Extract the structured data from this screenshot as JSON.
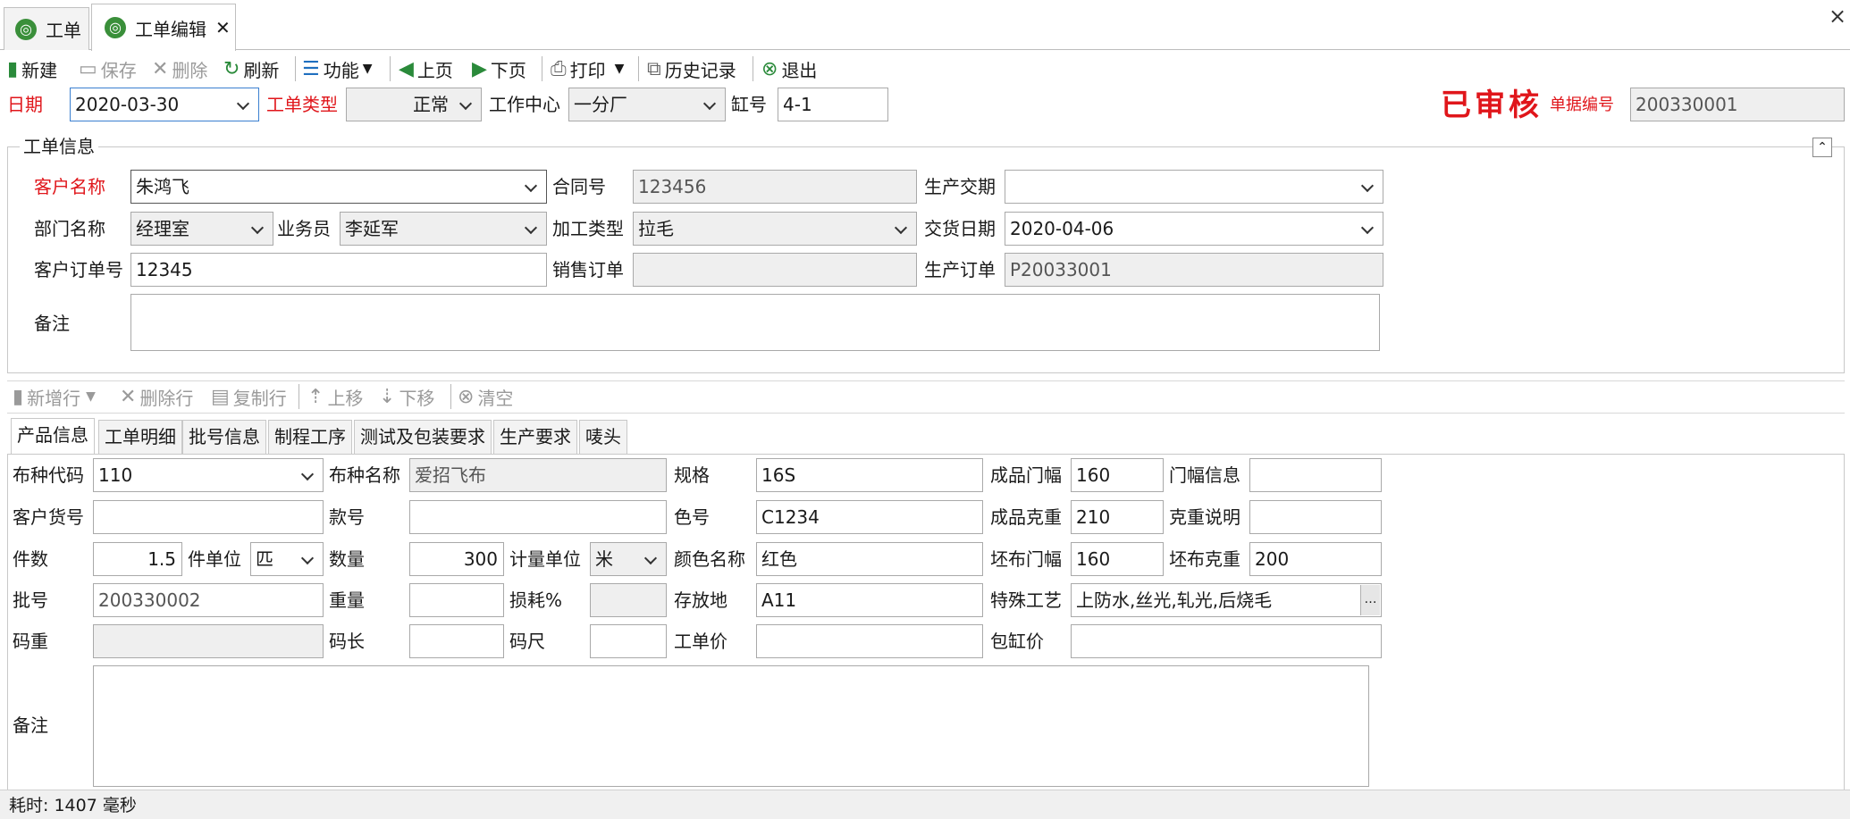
{
  "tabs": [
    {
      "label": "工单"
    },
    {
      "label": "工单编辑"
    }
  ],
  "window_close": "×",
  "toolbar": {
    "new": "新建",
    "save": "保存",
    "delete": "删除",
    "refresh": "刷新",
    "func": "功能",
    "prev": "上页",
    "next": "下页",
    "print": "打印",
    "history": "历史记录",
    "exit": "退出"
  },
  "header": {
    "date_label": "日期",
    "date": "2020-03-30",
    "type_label": "工单类型",
    "type": "正常",
    "center_label": "工作中心",
    "center": "一分厂",
    "vat_label": "缸号",
    "vat": "4-1",
    "stamp": "已审核",
    "docno_label": "单据编号",
    "docno": "200330001"
  },
  "info": {
    "group": "工单信息",
    "customer_label": "客户名称",
    "customer": "朱鸿飞",
    "contract_label": "合同号",
    "contract": "123456",
    "prod_due_label": "生产交期",
    "prod_due": "",
    "dept_label": "部门名称",
    "dept": "经理室",
    "sales_label": "业务员",
    "sales": "李延军",
    "proc_label": "加工类型",
    "proc": "拉毛",
    "delivery_label": "交货日期",
    "delivery": "2020-04-06",
    "cust_order_label": "客户订单号",
    "cust_order": "12345",
    "sales_order_label": "销售订单",
    "sales_order": "",
    "prod_order_label": "生产订单",
    "prod_order": "P20033001",
    "remark_label": "备注",
    "remark": ""
  },
  "rowbar": {
    "add": "新增行",
    "del": "删除行",
    "copy": "复制行",
    "up": "上移",
    "down": "下移",
    "clear": "清空"
  },
  "ptabs": [
    "产品信息",
    "工单明细",
    "批号信息",
    "制程工序",
    "测试及包装要求",
    "生产要求",
    "唛头"
  ],
  "product": {
    "code_label": "布种代码",
    "code": "110",
    "name_label": "布种名称",
    "name": "爱招飞布",
    "spec_label": "规格",
    "spec": "16S",
    "width_label": "成品门幅",
    "width": "160",
    "winfo_label": "门幅信息",
    "winfo": "",
    "cargo_label": "客户货号",
    "cargo": "",
    "style_label": "款号",
    "style": "",
    "color_no_label": "色号",
    "color_no": "C1234",
    "weight_label": "成品克重",
    "weight": "210",
    "wnote_label": "克重说明",
    "wnote": "",
    "pcs_label": "件数",
    "pcs": "1.5",
    "pcs_unit_label": "件单位",
    "pcs_unit": "匹",
    "qty_label": "数量",
    "qty": "300",
    "unit_label": "计量单位",
    "unit": "米",
    "color_label": "颜色名称",
    "color": "红色",
    "gwidth_label": "坯布门幅",
    "gwidth": "160",
    "gweight_label": "坯布克重",
    "gweight": "200",
    "lot_label": "批号",
    "lot": "200330002",
    "mass_label": "重量",
    "mass": "",
    "loss_label": "损耗%",
    "loss": "",
    "store_label": "存放地",
    "store": "A11",
    "craft_label": "特殊工艺",
    "craft": "上防水,丝光,轧光,后烧毛",
    "ydw_label": "码重",
    "ydw": "",
    "ydl_label": "码长",
    "ydl": "",
    "yds_label": "码尺",
    "yds": "",
    "price_label": "工单价",
    "price": "",
    "vatprice_label": "包缸价",
    "vatprice": "",
    "remark_label": "备注",
    "remark": ""
  },
  "status": "耗时: 1407 毫秒",
  "colors": {
    "red": "#e0161b",
    "green": "#2a8a3a",
    "blue": "#1f6fbf"
  }
}
